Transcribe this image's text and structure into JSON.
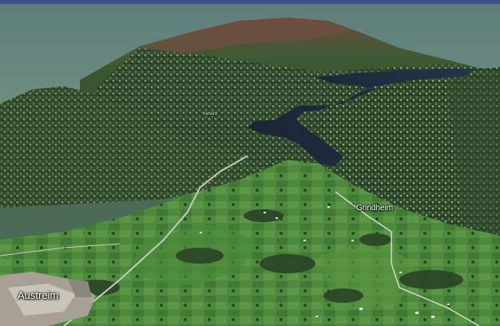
{
  "map": {
    "view": "3d-terrain-aerial",
    "colors": {
      "sky_top": "#5a7a7c",
      "sky_bottom": "#6b8b80",
      "forest": "#2d4a2a",
      "field": "#4e8a3e",
      "lake": "#1c2a3a",
      "mountain_top": "#6a4a3a"
    },
    "places": [
      {
        "id": "austreim",
        "name": "Austreim"
      },
      {
        "id": "grindheim",
        "name": "Grindheim"
      },
      {
        "id": "small",
        "name": "Innvird"
      }
    ]
  }
}
